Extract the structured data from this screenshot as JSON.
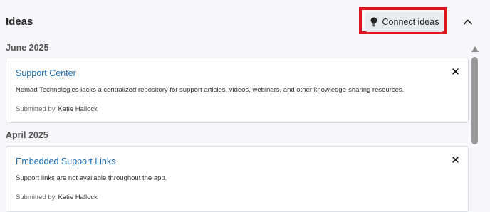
{
  "header": {
    "title": "Ideas",
    "connect_label": "Connect ideas"
  },
  "groups": [
    {
      "label": "June 2025",
      "card": {
        "title": "Support Center",
        "description": "Nomad Technologies lacks a centralized repository for support articles, videos, webinars, and other knowledge-sharing resources.",
        "submitted_by_label": "Submitted by",
        "author": "Katie Hallock"
      }
    },
    {
      "label": "April 2025",
      "card": {
        "title": "Embedded Support Links",
        "description": "Support links are not available throughout the app.",
        "submitted_by_label": "Submitted by",
        "author": "Katie Hallock"
      }
    }
  ],
  "icons": {
    "connect": "lightbulb-icon",
    "collapse": "chevron-up-icon",
    "close": "close-icon",
    "scroll_up": "triangle-up-icon"
  },
  "colors": {
    "highlight": "#e0141e",
    "link": "#1f6fb5",
    "button_bg": "#e7eaee",
    "panel_bg": "#f6f8fb"
  }
}
